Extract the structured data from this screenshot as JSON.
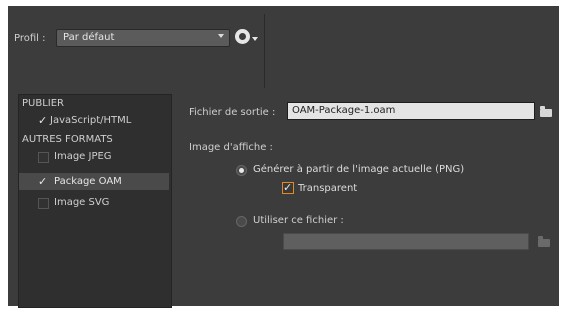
{
  "profile": {
    "label": "Profil :",
    "selected": "Par défaut"
  },
  "sidebar": {
    "sections": [
      {
        "heading": "PUBLIER"
      },
      {
        "heading": "AUTRES FORMATS"
      }
    ],
    "items": [
      {
        "label": "JavaScript/HTML",
        "checked": true
      },
      {
        "label": "Image JPEG",
        "checked": false
      },
      {
        "label": "Package OAM",
        "checked": true
      },
      {
        "label": "Image SVG",
        "checked": false
      }
    ]
  },
  "output": {
    "label": "Fichier de sortie :",
    "value": "OAM-Package-1.oam"
  },
  "poster": {
    "label": "Image d'affiche :",
    "option_generate": "Générer à partir de l'image actuelle (PNG)",
    "transparent_label": "Transparent",
    "transparent_checked": true,
    "option_file": "Utiliser ce fichier :",
    "file_value": ""
  },
  "colors": {
    "panel": "#3c3c3c",
    "accent_checkbox": "#e28a21"
  }
}
